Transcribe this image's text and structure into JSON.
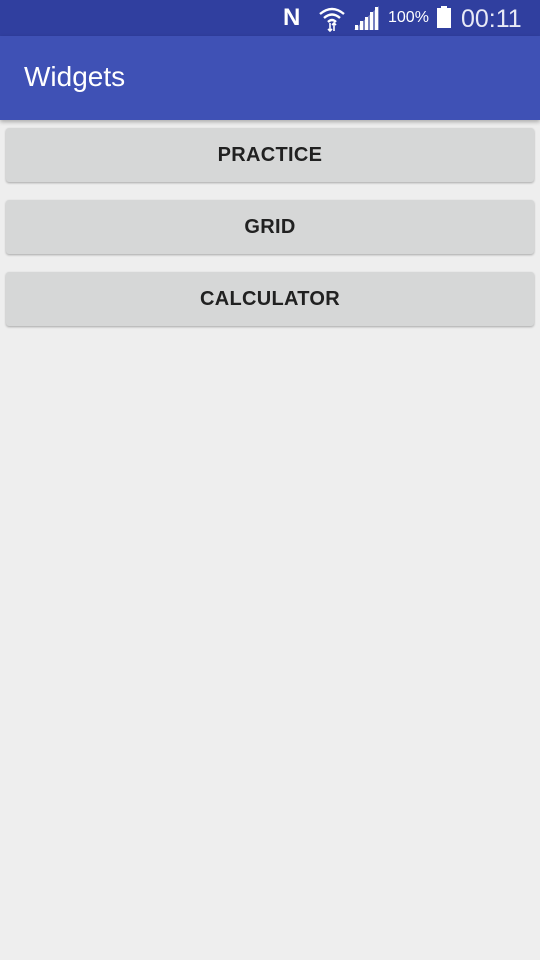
{
  "status_bar": {
    "n_label": "N",
    "battery_percent": "100%",
    "time": "00:11",
    "icons": [
      "n-icon",
      "wifi-icon",
      "signal-icon",
      "battery-icon"
    ]
  },
  "app_bar": {
    "title": "Widgets",
    "color": "#3f51b5",
    "status_color": "#303f9f"
  },
  "buttons": [
    {
      "label": "PRACTICE"
    },
    {
      "label": "GRID"
    },
    {
      "label": "CALCULATOR"
    }
  ],
  "colors": {
    "background": "#eeeeee",
    "button_bg": "#d6d7d7",
    "button_text": "#212121"
  }
}
